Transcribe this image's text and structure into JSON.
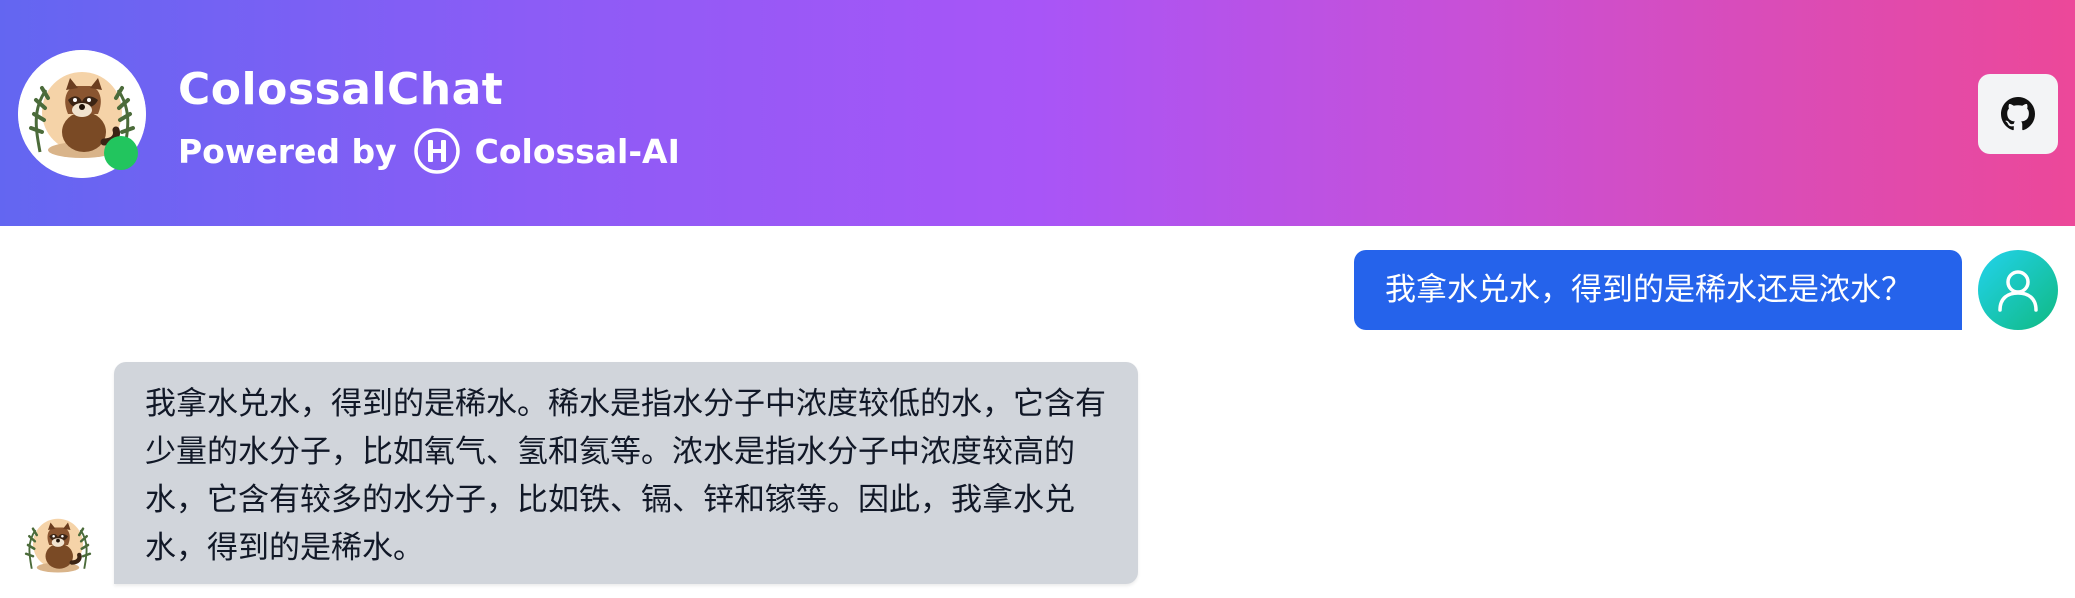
{
  "header": {
    "title": "ColossalChat",
    "powered_by_label": "Powered by",
    "powered_by_brand": "Colossal-AI",
    "online": true,
    "github_icon": "github-icon"
  },
  "messages": [
    {
      "role": "user",
      "text": "我拿水兑水，得到的是稀水还是浓水？",
      "avatar_icon": "user-icon"
    },
    {
      "role": "assistant",
      "text": "我拿水兑水，得到的是稀水。稀水是指水分子中浓度较低的水，它含有少量的水分子，比如氧气、氢和氦等。浓水是指水分子中浓度较高的水，它含有较多的水分子，比如铁、镉、锌和镓等。因此，我拿水兑水，得到的是稀水。",
      "avatar_icon": "raccoon-bot-avatar"
    }
  ],
  "colors": {
    "header_gradient_start": "#6366f1",
    "header_gradient_mid": "#a855f7",
    "header_gradient_end": "#ec4899",
    "user_bubble": "#2563eb",
    "assistant_bubble": "#d1d5db",
    "online_dot": "#22c55e"
  }
}
